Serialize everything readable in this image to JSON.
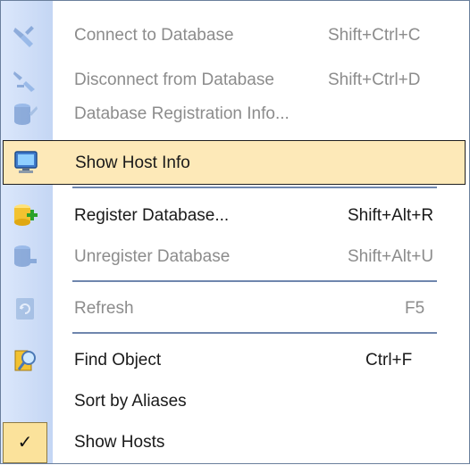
{
  "menu": {
    "items": [
      {
        "label": "Connect to Database",
        "shortcut": "Shift+Ctrl+C",
        "icon": "connect-plug-icon",
        "enabled": false
      },
      {
        "label": "Disconnect from Database",
        "shortcut": "Shift+Ctrl+D",
        "icon": "disconnect-plug-icon",
        "enabled": false
      },
      {
        "label": "Database Registration Info...",
        "shortcut": "",
        "icon": "database-info-icon",
        "enabled": false
      },
      {
        "label": "Show Host Info",
        "shortcut": "",
        "icon": "monitor-icon",
        "enabled": true,
        "highlighted": true
      },
      {
        "label": "Register Database...",
        "shortcut": "Shift+Alt+R",
        "icon": "database-add-icon",
        "enabled": true
      },
      {
        "label": "Unregister Database",
        "shortcut": "Shift+Alt+U",
        "icon": "database-remove-icon",
        "enabled": false
      },
      {
        "label": "Refresh",
        "shortcut": "F5",
        "icon": "refresh-icon",
        "enabled": false
      },
      {
        "label": "Find Object",
        "shortcut": "Ctrl+F",
        "icon": "find-object-icon",
        "enabled": true
      },
      {
        "label": "Sort by Aliases",
        "shortcut": "",
        "icon": "",
        "enabled": true
      },
      {
        "label": "Show Hosts",
        "shortcut": "",
        "icon": "checkmark-icon",
        "enabled": true,
        "checked": true
      }
    ],
    "check_glyph": "✓"
  },
  "colors": {
    "highlight": "#fde9b8",
    "gutter": "#c4d6f4",
    "separator": "#6f86ad",
    "disabled_text": "#8c8c8c"
  }
}
